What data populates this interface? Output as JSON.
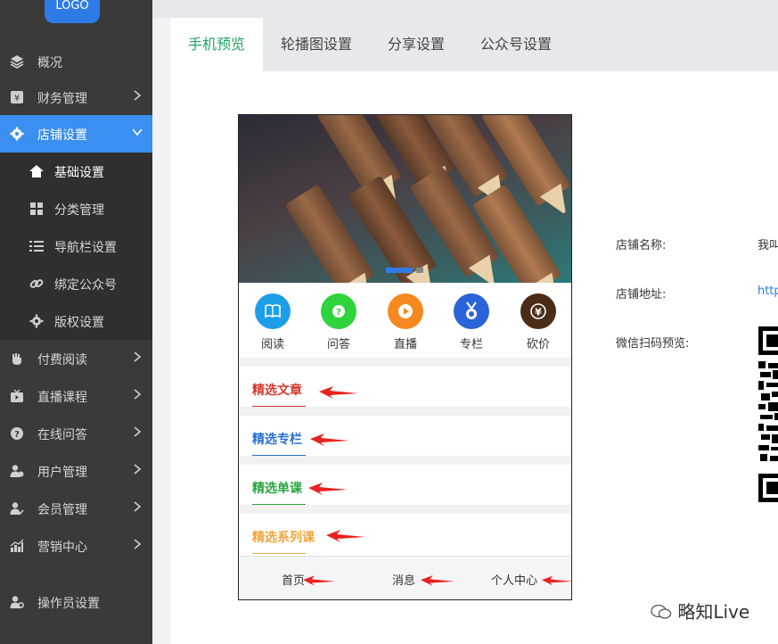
{
  "sidebar": {
    "logo_text": "LOGO",
    "items": [
      {
        "label": "概况",
        "icon": "layers-icon"
      },
      {
        "label": "财务管理",
        "icon": "finance-icon"
      },
      {
        "label": "店铺设置",
        "icon": "gear-icon"
      },
      {
        "label": "付费阅读",
        "icon": "hand-icon"
      },
      {
        "label": "直播课程",
        "icon": "tv-icon"
      },
      {
        "label": "在线问答",
        "icon": "question-icon"
      },
      {
        "label": "用户管理",
        "icon": "users-icon"
      },
      {
        "label": "会员管理",
        "icon": "member-icon"
      },
      {
        "label": "营销中心",
        "icon": "chart-icon"
      },
      {
        "label": "操作员设置",
        "icon": "operator-icon"
      }
    ],
    "sub_items": [
      {
        "label": "基础设置",
        "icon": "home-icon"
      },
      {
        "label": "分类管理",
        "icon": "grid-icon"
      },
      {
        "label": "导航栏设置",
        "icon": "list-icon"
      },
      {
        "label": "绑定公众号",
        "icon": "link-icon"
      },
      {
        "label": "版权设置",
        "icon": "gear-icon"
      }
    ]
  },
  "tabs": [
    "手机预览",
    "轮播图设置",
    "分享设置",
    "公众号设置"
  ],
  "preview": {
    "categories": [
      {
        "label": "阅读",
        "color": "#1e9ee8",
        "icon": "book-icon"
      },
      {
        "label": "问答",
        "color": "#2fd33b",
        "icon": "question-icon"
      },
      {
        "label": "直播",
        "color": "#f5891f",
        "icon": "play-icon"
      },
      {
        "label": "专栏",
        "color": "#2b64d8",
        "icon": "medal-icon"
      },
      {
        "label": "砍价",
        "color": "#4a2c18",
        "icon": "yen-icon"
      }
    ],
    "sections": [
      {
        "label": "精选文章",
        "color": "#d33a2c"
      },
      {
        "label": "精选专栏",
        "color": "#2a6fd6"
      },
      {
        "label": "精选单课",
        "color": "#2aa63f"
      },
      {
        "label": "精选系列课",
        "color": "#f0a53c"
      }
    ],
    "bottom_nav": [
      "首页",
      "消息",
      "个人中心"
    ]
  },
  "info": {
    "shop_name_label": "店铺名称:",
    "shop_name_value": "我叫",
    "shop_url_label": "店铺地址:",
    "shop_url_value": "http",
    "qr_label": "微信扫码预览:"
  },
  "watermark": "略知Live",
  "colors": {
    "accent": "#3b8ff0",
    "tab_active": "#1fa463",
    "arrow": "#e8211f"
  }
}
